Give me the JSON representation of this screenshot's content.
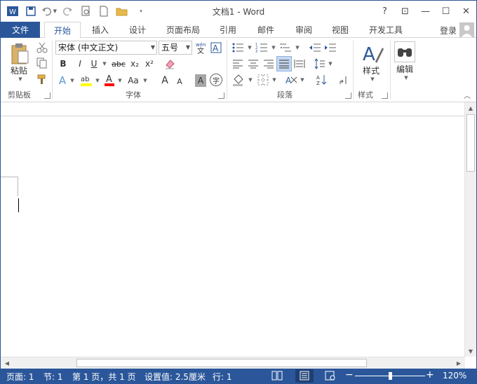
{
  "app": {
    "title": "文档1 - Word"
  },
  "window_controls": {
    "help": "?",
    "ribbon_options": "⊡",
    "minimize": "—",
    "maximize": "☐",
    "close": "✕"
  },
  "tabs": {
    "file": "文件",
    "items": [
      "开始",
      "插入",
      "设计",
      "页面布局",
      "引用",
      "邮件",
      "审阅",
      "视图",
      "开发工具"
    ],
    "login": "登录"
  },
  "ribbon": {
    "clipboard": {
      "paste": "粘贴",
      "group": "剪贴板"
    },
    "font": {
      "font_name": "宋体 (中文正文)",
      "font_size": "五号",
      "bold": "B",
      "italic": "I",
      "underline": "U",
      "strike": "abc",
      "subscript": "x₂",
      "superscript": "x²",
      "text_effects": "A",
      "font_color": "A",
      "change_case": "Aa",
      "grow": "A",
      "shrink": "A",
      "char_shading": "A",
      "enclose": "字",
      "group": "字体"
    },
    "paragraph": {
      "group": "段落"
    },
    "styles": {
      "label": "样式",
      "group": "样式"
    },
    "editing": {
      "label": "编辑"
    }
  },
  "status": {
    "page": "页面: 1",
    "section": "节: 1",
    "page_of": "第 1 页，共 1 页",
    "setting": "设置值: 2.5厘米",
    "line": "行: 1",
    "zoom": "120%"
  },
  "colors": {
    "accent": "#2b579a",
    "highlight": "#ffff00",
    "font_color": "#ff0000"
  }
}
